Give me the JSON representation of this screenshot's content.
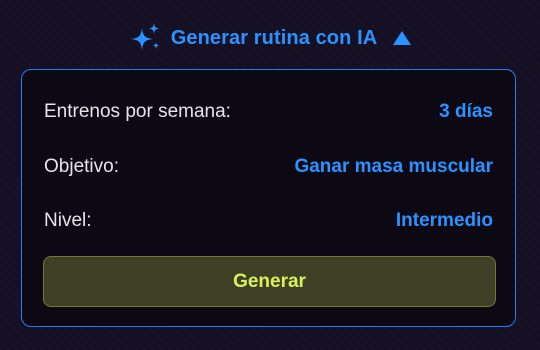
{
  "header": {
    "icon": "sparkles-icon",
    "title": "Generar rutina con IA",
    "toggle_icon": "triangle-up-icon"
  },
  "form": {
    "rows": [
      {
        "label": "Entrenos por semana:",
        "value": "3 días"
      },
      {
        "label": "Objetivo:",
        "value": "Ganar masa muscular"
      },
      {
        "label": "Nivel:",
        "value": "Intermedio"
      }
    ],
    "generate_label": "Generar"
  },
  "colors": {
    "accent": "#2a93ff",
    "card_border": "#2a7cf0",
    "button_text": "#d8f25a",
    "button_bg": "#3e4026",
    "background": "#150f24"
  }
}
